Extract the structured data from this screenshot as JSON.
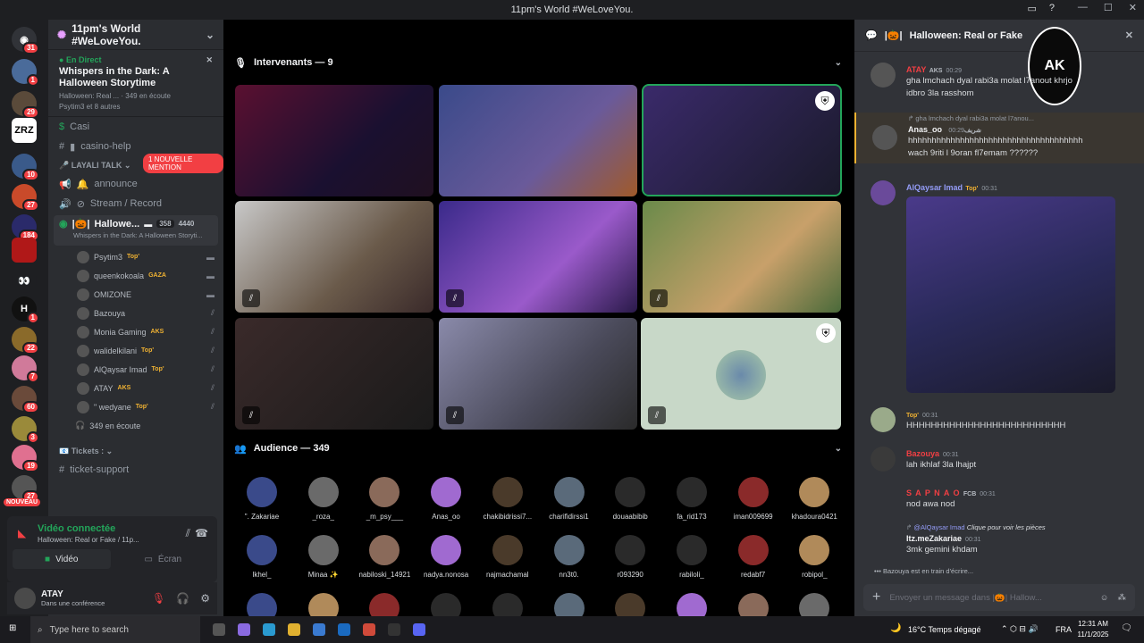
{
  "window": {
    "title": "11pm's World #WeLoveYou."
  },
  "servers": {
    "badges": [
      "31",
      "1",
      "29",
      "",
      "10",
      "27",
      "184",
      "",
      "",
      "1",
      "22",
      "7",
      "60",
      "3",
      "19",
      "27"
    ],
    "zrz": "ZRZ",
    "new_label": "NOUVEAU"
  },
  "guild": {
    "name": "11pm's World #WeLoveYou."
  },
  "event": {
    "live": "En Direct",
    "title": "Whispers in the Dark: A Halloween Storytime",
    "channel": "Halloween: Real ...",
    "listeners": "349 en écoute",
    "attendees": "Psytim3 et 8 autres"
  },
  "channels": {
    "casino": "Casi",
    "mention": "1 NOUVELLE MENTION",
    "casino_help": "casino-help",
    "cat_layali": "LAYALI TALK",
    "announce": "announce",
    "stream": "Stream / Record",
    "halloween": "Hallowe...",
    "halloween_count": "358",
    "halloween_cap": "4440",
    "halloween_sub": "Whispers in the Dark: A Halloween Storyti...",
    "cat_tickets": "Tickets :",
    "ticket_support": "ticket-support"
  },
  "voice_users": [
    {
      "name": "Psytim3",
      "tag": "Top'"
    },
    {
      "name": "queenkokoala",
      "tag": "GAZA"
    },
    {
      "name": "OMIZONE",
      "tag": ""
    },
    {
      "name": "Bazouya",
      "tag": ""
    },
    {
      "name": "Monia Gaming",
      "tag": "AKS"
    },
    {
      "name": "walidelkilani",
      "tag": "Top'"
    },
    {
      "name": "AlQaysar Imad",
      "tag": "Top'"
    },
    {
      "name": "ATAY",
      "tag": "AKS"
    },
    {
      "name": "\" wedyane",
      "tag": "Top'"
    }
  ],
  "listeners_line": "349 en écoute",
  "voice_panel": {
    "status": "Vidéo connectée",
    "channel": "Halloween: Real or Fake / 11p...",
    "video": "Vidéo",
    "screen": "Écran"
  },
  "user": {
    "name": "ATAY",
    "status": "Dans une conférence"
  },
  "stage": {
    "speakers": "Intervenants — 9",
    "audience": "Audience — 349"
  },
  "audience": [
    "\". Zakariae",
    "_roza_",
    "_m_psy___",
    "Anas_oo",
    "chakibidrissi7...",
    "charifidirssi1",
    "douaabibib",
    "fa_rid173",
    "iman009699",
    "khadoura0421",
    "lkhel_",
    "Minaa ✨",
    "nabiloski_14921",
    "nadya.nonosa",
    "najmachamal",
    "nn3t0.",
    "r093290",
    "rabiloli_",
    "redabf7",
    "robipol_"
  ],
  "chat": {
    "title": "Halloween: Real or Fake",
    "messages": [
      {
        "author": "ATAY",
        "tag": "AKS",
        "time": "00:29",
        "text": "gha lmchach dyal rabi3a molat l7anout khrjo idbro 3la rasshom",
        "color": "#f23f43"
      },
      {
        "reply": "gha lmchach dyal rabi3a molat l7anou...",
        "author": "Anas_oo",
        "tag": "شريف",
        "time": "00:29",
        "text": "hhhhhhhhhhhhhhhhhhhhhhhhhhhhhhhhhhhhh wach 9riti l 9oran fl7emam ??????",
        "color": "#f2f3f5"
      },
      {
        "author": "AlQaysar Imad",
        "tag": "Top'",
        "time": "00:31",
        "text": "",
        "color": "#949cf7"
      },
      {
        "author": "",
        "tag": "Top'",
        "time": "00:31",
        "text": "HHHHHHHHHHHHHHHHHHHHHHHHHH",
        "color": "#f23f43"
      },
      {
        "author": "Bazouya",
        "tag": "",
        "time": "00:31",
        "text": "lah ikhlaf 3la lhajpt",
        "color": "#f23f43"
      },
      {
        "author": "S A P N A O",
        "tag": "FCB",
        "time": "00:31",
        "text": "nod awa nod",
        "color": "#f23f43"
      },
      {
        "reply": "@AlQaysar Imad",
        "reply_extra": "Clique pour voir les pièces",
        "author": "Itz.meZakariae",
        "tag": "",
        "time": "00:31",
        "text": "3mk gemini khdam",
        "color": "#f2f3f5"
      }
    ],
    "typing": "Bazouya est en train d'écrire...",
    "input_placeholder": "Envoyer un message dans",
    "input_channel": "Hallow..."
  },
  "taskbar": {
    "search": "Type here to search",
    "weather": "16°C  Temps dégagé",
    "lang": "FRA",
    "time": "12:31 AM",
    "date": "11/1/2025"
  }
}
